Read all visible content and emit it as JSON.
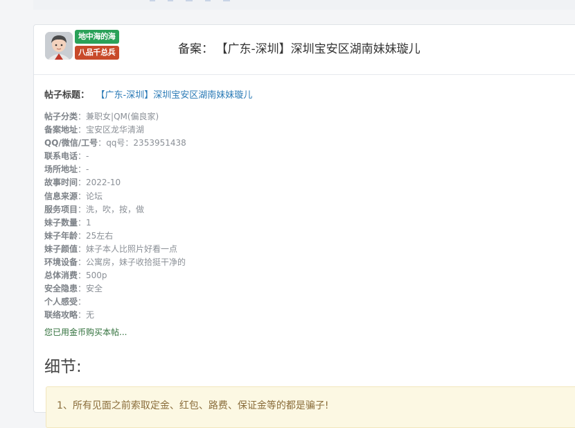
{
  "header": {
    "badges": [
      "地中海的海",
      "八品千总兵"
    ],
    "title_label": "备案：",
    "title_value": "【广东-深圳】深圳宝安区湖南妹妹璇儿"
  },
  "post": {
    "title_label": "帖子标题：",
    "title_value": "【广东-深圳】深圳宝安区湖南妹妹璇儿",
    "fields": [
      {
        "key": "帖子分类",
        "value": "兼职女|QM(偏良家)"
      },
      {
        "key": "备案地址",
        "value": "宝安区龙华清湖"
      },
      {
        "key": "QQ/微信/工号",
        "value": "qq号：2353951438"
      },
      {
        "key": "联系电话",
        "value": "-"
      },
      {
        "key": "场所地址",
        "value": "-"
      },
      {
        "key": "故事时间",
        "value": "2022-10"
      },
      {
        "key": "信息来源",
        "value": "论坛"
      },
      {
        "key": "服务项目",
        "value": "洗，吹，按，做"
      },
      {
        "key": "妹子数量",
        "value": "1"
      },
      {
        "key": "妹子年龄",
        "value": "25左右"
      },
      {
        "key": "妹子颜值",
        "value": "妹子本人比照片好看一点"
      },
      {
        "key": "环境设备",
        "value": "公寓房，妹子收拾挺干净的"
      },
      {
        "key": "总体消费",
        "value": "500p"
      },
      {
        "key": "安全隐患",
        "value": "安全"
      },
      {
        "key": "个人感受",
        "value": ""
      },
      {
        "key": "联络攻略",
        "value": "无"
      }
    ],
    "separator": "：",
    "purchased_text": "您已用金币购买本帖..."
  },
  "details": {
    "heading": "细节:",
    "notice": "1、所有见面之前索取定金、红包、路费、保证金等的都是骗子!"
  }
}
